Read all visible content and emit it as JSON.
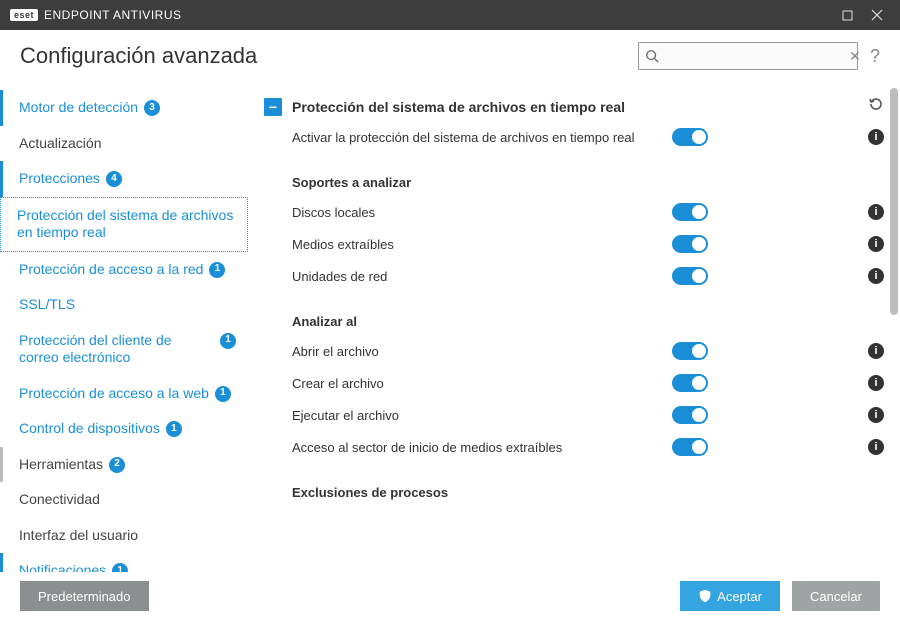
{
  "window": {
    "logo": "eset",
    "title": "ENDPOINT ANTIVIRUS"
  },
  "header": {
    "title": "Configuración avanzada",
    "search_placeholder": "",
    "help": "?"
  },
  "sidebar": [
    {
      "label": "Motor de detección",
      "badge": "3",
      "kind": "top-blue",
      "marked": true
    },
    {
      "label": "Actualización",
      "kind": "top"
    },
    {
      "label": "Protecciones",
      "badge": "4",
      "kind": "top-blue",
      "marked": true
    },
    {
      "label": "Protección del sistema de archivos en tiempo real",
      "kind": "sub-blue",
      "selected": true
    },
    {
      "label": "Protección de acceso a la red",
      "badge": "1",
      "kind": "sub-blue"
    },
    {
      "label": "SSL/TLS",
      "kind": "sub-blue"
    },
    {
      "label": "Protección del cliente de correo electrónico",
      "badge": "1",
      "kind": "sub-blue"
    },
    {
      "label": "Protección de acceso a la web",
      "badge": "1",
      "kind": "sub-blue"
    },
    {
      "label": "Control de dispositivos",
      "badge": "1",
      "kind": "sub-blue"
    },
    {
      "label": "Herramientas",
      "badge": "2",
      "kind": "top",
      "marked": true
    },
    {
      "label": "Conectividad",
      "kind": "top"
    },
    {
      "label": "Interfaz del usuario",
      "kind": "top"
    },
    {
      "label": "Notificaciones",
      "badge": "1",
      "kind": "top-blue",
      "marked": true
    }
  ],
  "content": {
    "section_title": "Protección del sistema de archivos en tiempo real",
    "enable_row": "Activar la protección del sistema de archivos en tiempo real",
    "group1_title": "Soportes a analizar",
    "group1_rows": [
      "Discos locales",
      "Medios extraíbles",
      "Unidades de red"
    ],
    "group2_title": "Analizar al",
    "group2_rows": [
      "Abrir el archivo",
      "Crear el archivo",
      "Ejecutar el archivo",
      "Acceso al sector de inicio de medios extraíbles"
    ],
    "group3_title": "Exclusiones de procesos"
  },
  "footer": {
    "default": "Predeterminado",
    "accept": "Aceptar",
    "cancel": "Cancelar"
  },
  "badge_color": "#1a8fd8"
}
